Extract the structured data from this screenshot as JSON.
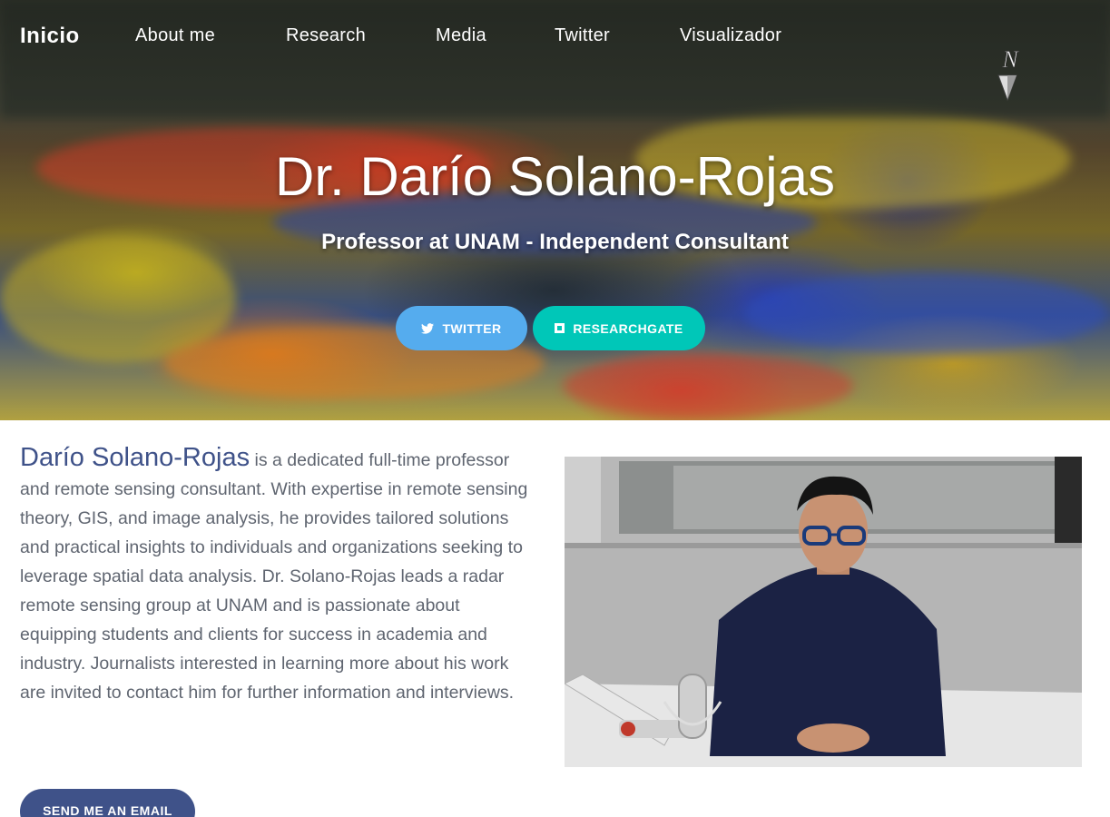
{
  "nav": {
    "brand": "Inicio",
    "links": [
      "About me",
      "Research",
      "Media",
      "Twitter",
      "Visualizador"
    ]
  },
  "hero": {
    "compass_letter": "N",
    "title": "Dr. Darío Solano-Rojas",
    "subtitle": "Professor at UNAM - Independent Consultant",
    "buttons": {
      "twitter": "TWITTER",
      "researchgate": "RESEARCHGATE"
    }
  },
  "bio": {
    "name": "Darío Solano-Rojas",
    "text": " is a dedicated full-time professor and remote sensing consultant. With expertise in remote sensing theory, GIS, and image analysis, he provides tailored solutions and practical insights to individuals and organizations seeking to leverage spatial data analysis. Dr. Solano-Rojas leads a radar remote sensing group at UNAM and is passionate about equipping students and clients for success in academia and industry. Journalists interested in learning more about his work are invited to contact him for further information and interviews."
  },
  "contact": {
    "email_button": "SEND ME AN EMAIL"
  },
  "colors": {
    "accent": "#3f5289",
    "twitter": "#55acee",
    "researchgate": "#00c7b8"
  },
  "icons": [
    "twitter-icon",
    "researchgate-icon",
    "north-arrow-icon"
  ]
}
